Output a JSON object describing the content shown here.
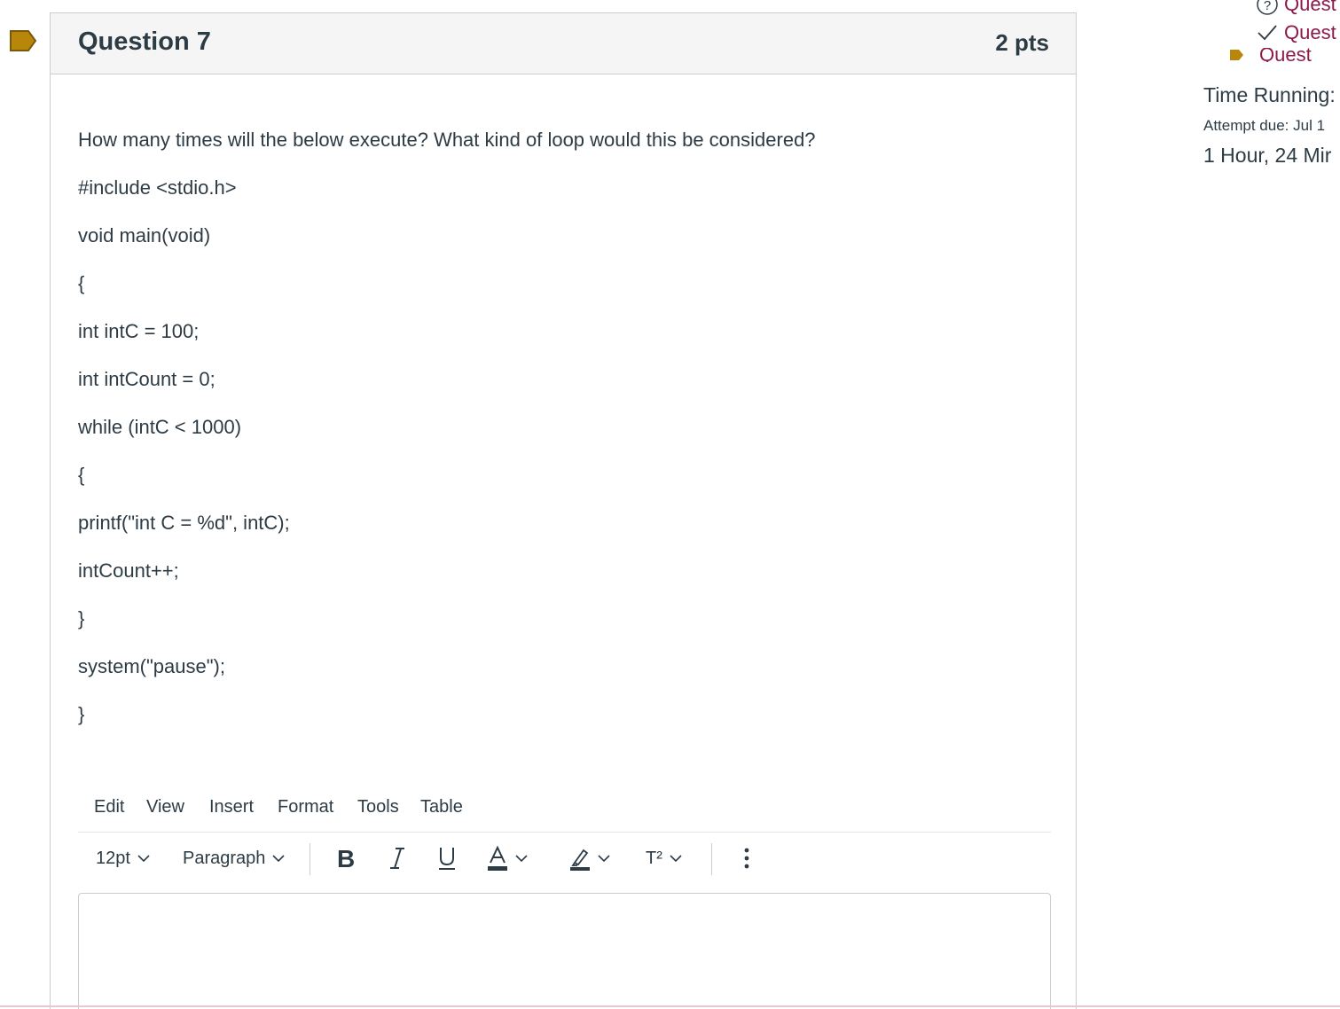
{
  "question": {
    "title": "Question 7",
    "points": "2 pts",
    "prompt": "How many times will the below execute? What kind of loop would this be considered?",
    "code_lines": [
      "#include <stdio.h>",
      "void main(void)",
      "{",
      "int intC = 100;",
      "int intCount = 0;",
      "while (intC < 1000)",
      "{",
      "printf(\"int C = %d\", intC);",
      "intCount++;",
      "}",
      "system(\"pause\");",
      "}"
    ]
  },
  "editor": {
    "menu": [
      "Edit",
      "View",
      "Insert",
      "Format",
      "Tools",
      "Table"
    ],
    "font_size": "12pt",
    "block_format": "Paragraph",
    "superscript_label": "T²"
  },
  "sidebar": {
    "questions": [
      {
        "label": "Quest",
        "status_icon": "question-circle-icon"
      },
      {
        "label": "Quest",
        "status_icon": "check-icon"
      },
      {
        "label": "Quest",
        "status_icon": "flag-icon"
      }
    ],
    "time_running_label": "Time Running:",
    "attempt_due": "Attempt due: Jul 1",
    "time_left": "1 Hour, 24 Mir"
  },
  "colors": {
    "flag": "#b8860b",
    "header_bg": "#f5f5f5",
    "border": "#c7cdd1",
    "link": "#8b1a4a",
    "text": "#2d3b45"
  }
}
